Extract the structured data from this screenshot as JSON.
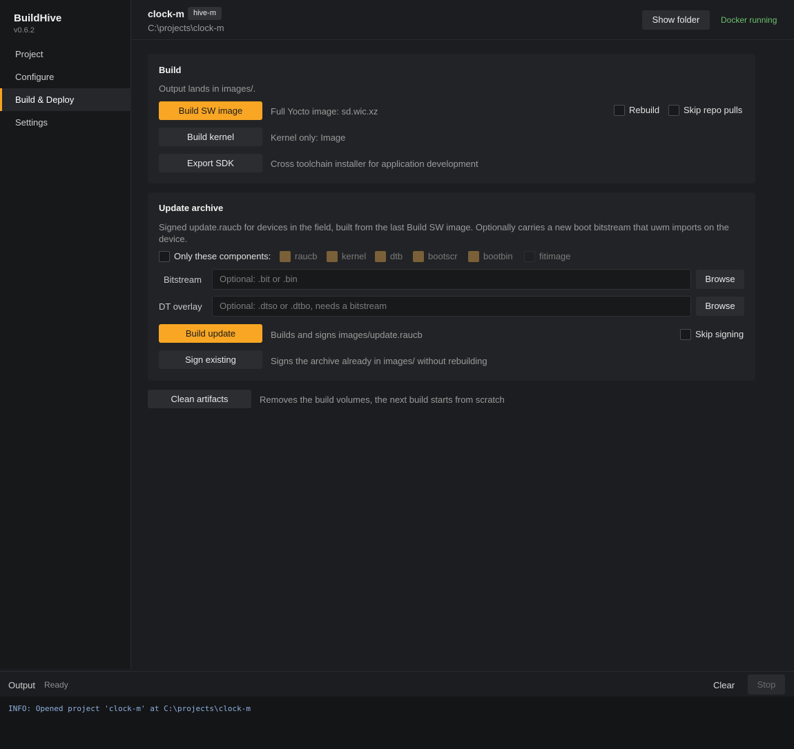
{
  "app": {
    "name": "BuildHive",
    "version": "v0.6.2"
  },
  "sidebar": {
    "items": [
      {
        "label": "Project"
      },
      {
        "label": "Configure"
      },
      {
        "label": "Build & Deploy",
        "active": true
      },
      {
        "label": "Settings"
      }
    ]
  },
  "header": {
    "project_name": "clock-m",
    "project_tag": "hive-m",
    "project_path": "C:\\projects\\clock-m",
    "show_folder_label": "Show folder",
    "docker_status": "Docker running"
  },
  "build": {
    "title": "Build",
    "subtitle": "Output lands in images/.",
    "actions": [
      {
        "label": "Build SW image",
        "desc": "Full Yocto image: sd.wic.xz",
        "primary": true
      },
      {
        "label": "Build kernel",
        "desc": "Kernel only: Image"
      },
      {
        "label": "Export SDK",
        "desc": "Cross toolchain installer for application development"
      }
    ],
    "options": {
      "rebuild": "Rebuild",
      "skip_repo_pulls": "Skip repo pulls"
    }
  },
  "update": {
    "title": "Update archive",
    "description": "Signed update.raucb for devices in the field, built from the last Build SW image. Optionally carries a new boot bitstream that uwm imports on the device.",
    "only_components_label": "Only these components:",
    "components": [
      "raucb",
      "kernel",
      "dtb",
      "bootscr",
      "bootbin",
      "fitimage"
    ],
    "bitstream": {
      "label": "Bitstream",
      "placeholder": "Optional: .bit or .bin",
      "browse": "Browse"
    },
    "dt_overlay": {
      "label": "DT overlay",
      "placeholder": "Optional: .dtso or .dtbo, needs a bitstream",
      "browse": "Browse"
    },
    "build_update": {
      "label": "Build update",
      "desc": "Builds and signs images/update.raucb"
    },
    "sign_existing": {
      "label": "Sign existing",
      "desc": "Signs the archive already in images/ without rebuilding"
    },
    "skip_signing": "Skip signing"
  },
  "clean": {
    "label": "Clean artifacts",
    "desc": "Removes the build volumes, the next build starts from scratch"
  },
  "output": {
    "title": "Output",
    "status": "Ready",
    "clear_label": "Clear",
    "stop_label": "Stop",
    "log_lines": [
      "INFO: Opened project 'clock-m' at C:\\projects\\clock-m"
    ]
  },
  "colors": {
    "accent": "#f8a624",
    "status_ok": "#6cc070"
  }
}
